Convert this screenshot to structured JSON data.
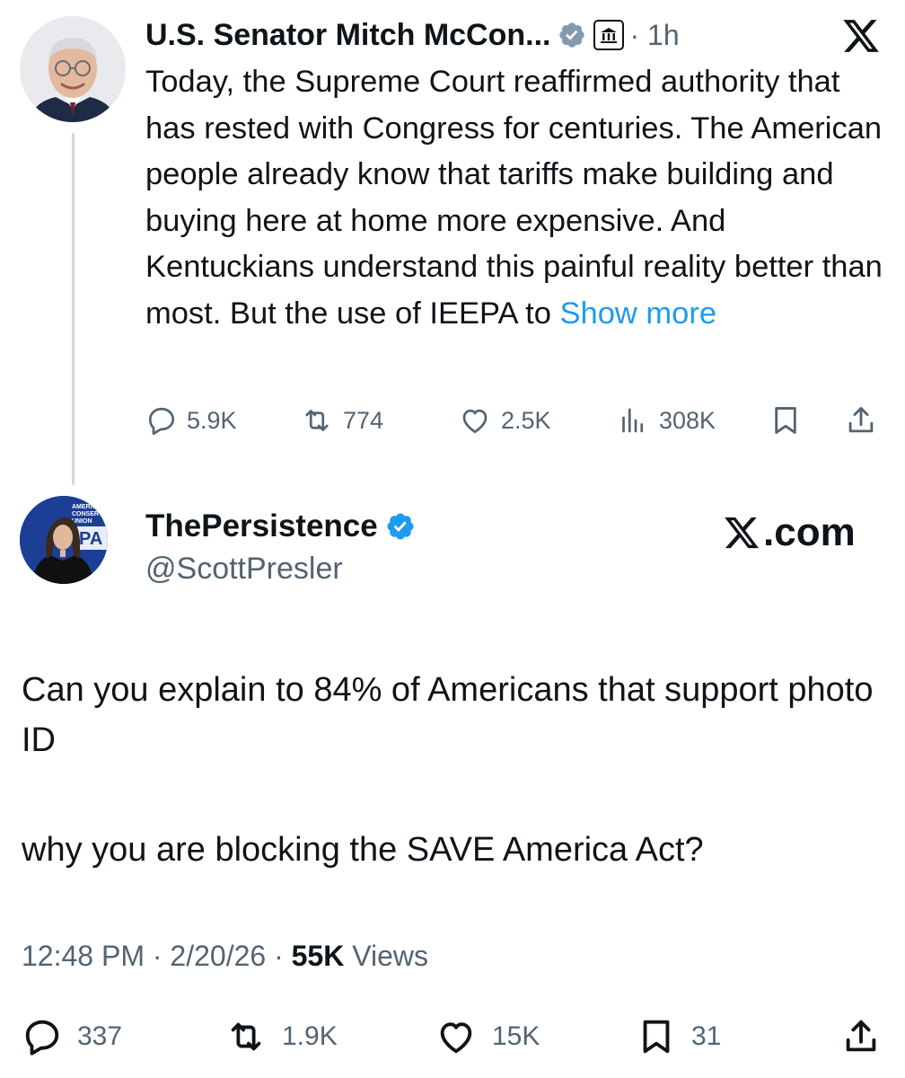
{
  "colors": {
    "text_primary": "#0f1419",
    "text_secondary": "#536471",
    "link": "#1d9bf0",
    "verified_blue": "#1d9bf0",
    "verified_gray": "#829aab",
    "thread_line": "#cfd9de"
  },
  "quoted_post": {
    "author_name": "U.S. Senator Mitch McCon...",
    "verified_badge": "gray-verified-icon",
    "affiliation_badge": "government-building-icon",
    "separator": "·",
    "time": "1h",
    "text": "Today, the Supreme Court reaffirmed authority that has rested with Congress for centuries. The American people already know that tariffs make building and buying here at home more expensive. And Kentuckians understand this painful reality better than most. But the use of IEEPA to ",
    "show_more": "Show more",
    "metrics": {
      "replies": "5.9K",
      "reposts": "774",
      "likes": "2.5K",
      "views": "308K"
    }
  },
  "main_post": {
    "author_name": "ThePersistence",
    "verified_badge": "blue-verified-icon",
    "handle": "@ScottPresler",
    "watermark": ".com",
    "avatar_banner_text": "AMERICAN CONSERVATIVE UNION",
    "text_line_1": "Can you explain to 84% of Americans that support photo ID",
    "text_line_2": "why you are blocking the SAVE America Act?",
    "timestamp": "12:48 PM",
    "date": "2/20/26",
    "separator": "·",
    "views_count": "55K",
    "views_label": "Views",
    "metrics": {
      "replies": "337",
      "reposts": "1.9K",
      "likes": "15K",
      "bookmarks": "31"
    }
  }
}
